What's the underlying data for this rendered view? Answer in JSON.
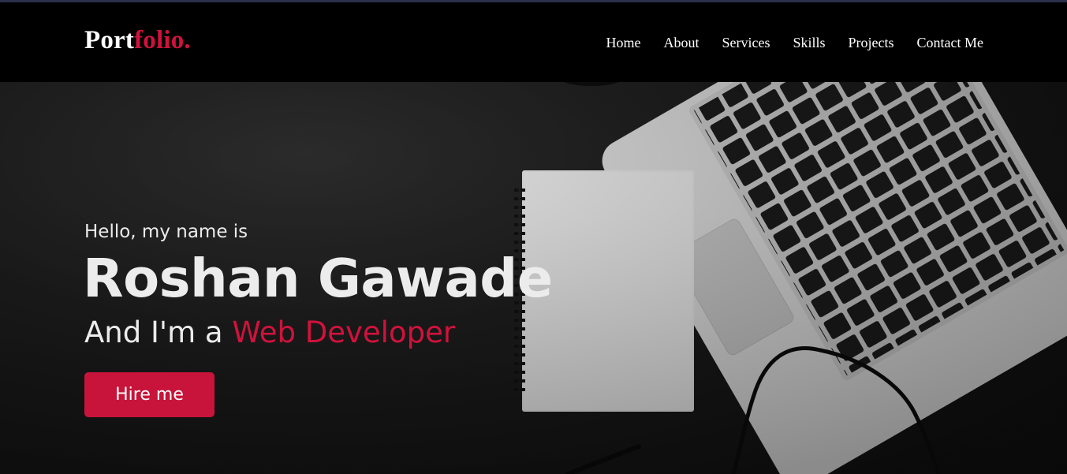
{
  "logo": {
    "primary": "Port",
    "accent": "folio."
  },
  "nav": {
    "items": [
      {
        "label": "Home"
      },
      {
        "label": "About"
      },
      {
        "label": "Services"
      },
      {
        "label": "Skills"
      },
      {
        "label": "Projects"
      },
      {
        "label": "Contact Me"
      }
    ]
  },
  "hero": {
    "greeting": "Hello, my name is",
    "name": "Roshan Gawade",
    "role_prefix": "And I'm a ",
    "role_highlight": "Web Developer",
    "cta_label": "Hire me"
  },
  "colors": {
    "accent": "#d0123c",
    "navbar_background": "#000000",
    "hero_background": "#1a1a1a",
    "text": "#ececec"
  },
  "background_image": "desk-laptop-notebook-photo"
}
